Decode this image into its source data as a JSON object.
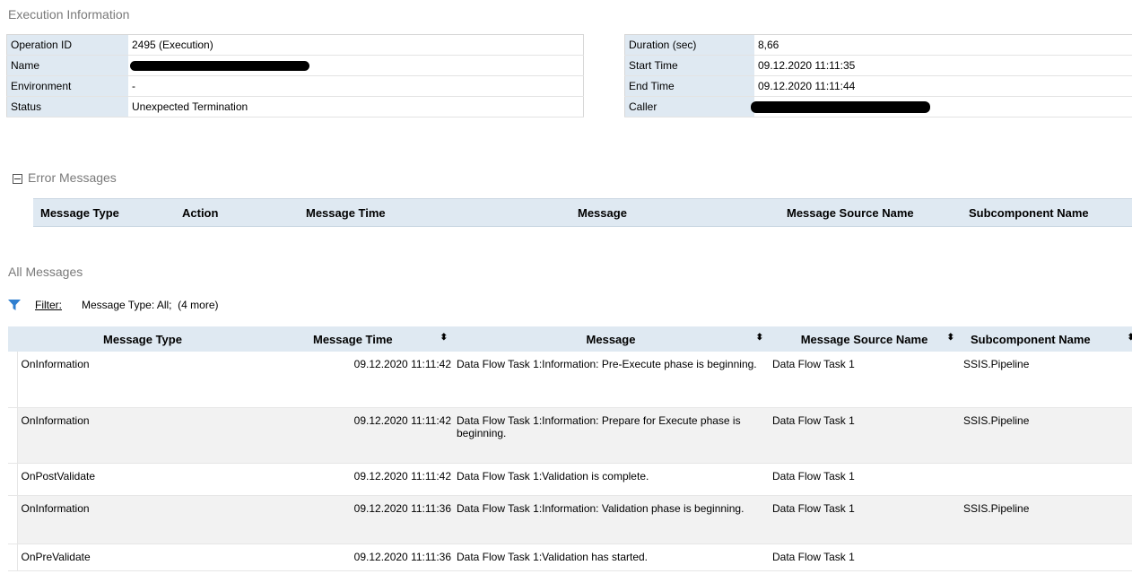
{
  "execution_info": {
    "title": "Execution Information",
    "left": [
      {
        "key": "Operation ID",
        "value": "2495 (Execution)"
      },
      {
        "key": "Name",
        "value": ""
      },
      {
        "key": "Environment",
        "value": "-"
      },
      {
        "key": "Status",
        "value": "Unexpected Termination"
      }
    ],
    "right": [
      {
        "key": "Duration (sec)",
        "value": "8,66"
      },
      {
        "key": "Start Time",
        "value": "09.12.2020 11:11:35"
      },
      {
        "key": "End Time",
        "value": "09.12.2020 11:11:44"
      },
      {
        "key": "Caller",
        "value": ""
      }
    ]
  },
  "error_messages": {
    "title": "Error Messages",
    "columns": [
      "Message Type",
      "Action",
      "Message Time",
      "Message",
      "Message Source Name",
      "Subcomponent Name"
    ]
  },
  "all_messages": {
    "title": "All Messages",
    "filter_label": "Filter:",
    "filter_text": "Message Type: All;  (4 more)",
    "columns": [
      "Message Type",
      "Message Time",
      "Message",
      "Message Source Name",
      "Subcomponent Name"
    ],
    "rows": [
      {
        "type": "OnInformation",
        "time": "09.12.2020 11:11:42",
        "message": "Data Flow Task 1:Information: Pre-Execute phase is beginning.",
        "source": "Data Flow Task 1",
        "sub": "SSIS.Pipeline"
      },
      {
        "type": "OnInformation",
        "time": "09.12.2020 11:11:42",
        "message": "Data Flow Task 1:Information: Prepare for Execute phase is beginning.",
        "source": "Data Flow Task 1",
        "sub": "SSIS.Pipeline"
      },
      {
        "type": "OnPostValidate",
        "time": "09.12.2020 11:11:42",
        "message": "Data Flow Task 1:Validation is complete.",
        "source": "Data Flow Task 1",
        "sub": ""
      },
      {
        "type": "OnInformation",
        "time": "09.12.2020 11:11:36",
        "message": "Data Flow Task 1:Information: Validation phase is beginning.",
        "source": "Data Flow Task 1",
        "sub": "SSIS.Pipeline"
      },
      {
        "type": "OnPreValidate",
        "time": "09.12.2020 11:11:36",
        "message": "Data Flow Task 1:Validation has started.",
        "source": "Data Flow Task 1",
        "sub": ""
      }
    ]
  },
  "colors": {
    "header_bg": "#dfe9f2",
    "filter_icon": "#2f7fd0"
  }
}
